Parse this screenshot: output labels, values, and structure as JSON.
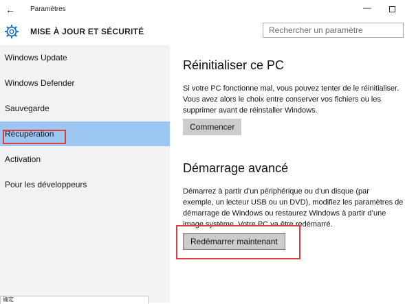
{
  "window": {
    "back_icon": "back-arrow-icon",
    "title": "Paramètres",
    "minimize_glyph": "—"
  },
  "header": {
    "icon": "gear-icon",
    "title": "MISE À JOUR ET SÉCURITÉ",
    "search_placeholder": "Rechercher un paramètre"
  },
  "sidebar": {
    "items": [
      {
        "label": "Windows Update"
      },
      {
        "label": "Windows Defender"
      },
      {
        "label": "Sauvegarde"
      },
      {
        "label": "Récupération",
        "selected": true
      },
      {
        "label": "Activation"
      },
      {
        "label": "Pour les développeurs"
      }
    ],
    "bottom_input_text": "确定"
  },
  "main": {
    "reset": {
      "title": "Réinitialiser ce PC",
      "lines": [
        "Si votre PC fonctionne mal, vous pouvez tenter de le réinitialiser.",
        "Vous avez alors le choix entre conserver vos fichiers ou les",
        "supprimer avant de réinstaller Windows."
      ],
      "button": "Commencer"
    },
    "advanced": {
      "title": "Démarrage avancé",
      "lines": [
        "Démarrez à partir d’un périphérique ou d’un disque (par",
        "exemple, un lecteur USB ou un DVD), modifiez les paramètres de",
        "démarrage de Windows ou restaurez Windows à partir d’une",
        "image système. Votre PC va être redémarré."
      ],
      "button": "Redémarrer maintenant"
    }
  },
  "colors": {
    "selected_bg": "#9dc7f3",
    "sidebar_bg": "#f2f2f2",
    "button_bg": "#cccccc",
    "highlight_border": "#e03c3c",
    "accent_icon": "#1e73be"
  }
}
